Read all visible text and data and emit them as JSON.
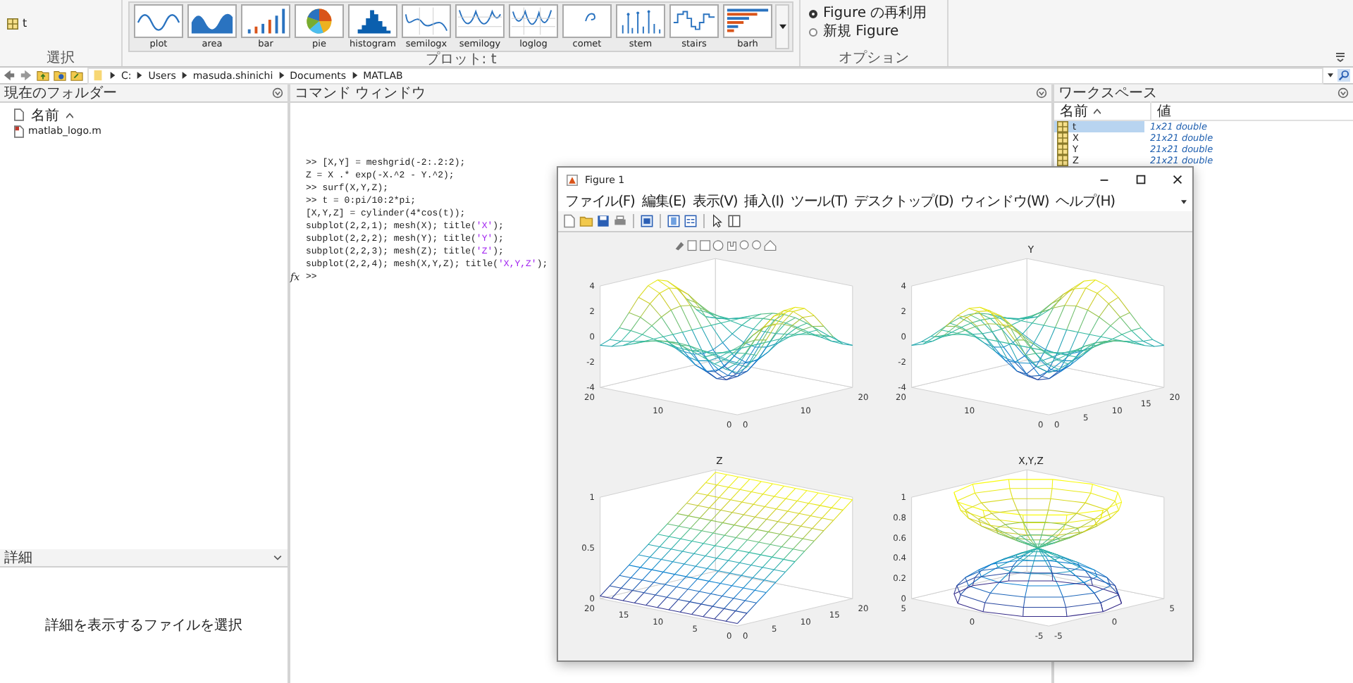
{
  "ribbon": {
    "variable": {
      "name": "t"
    },
    "select_label": "選択",
    "gallery": [
      {
        "label": "plot"
      },
      {
        "label": "area"
      },
      {
        "label": "bar"
      },
      {
        "label": "pie"
      },
      {
        "label": "histogram"
      },
      {
        "label": "semilogx"
      },
      {
        "label": "semilogy"
      },
      {
        "label": "loglog"
      },
      {
        "label": "comet"
      },
      {
        "label": "stem"
      },
      {
        "label": "stairs"
      },
      {
        "label": "barh"
      }
    ],
    "gallery_label": "プロット: t",
    "options": [
      {
        "label": "Figure の再利用",
        "selected": true
      },
      {
        "label": "新規 Figure",
        "selected": false
      }
    ],
    "options_label": "オプション"
  },
  "address_bar": {
    "path": [
      "C:",
      "Users",
      "masuda.shinichi",
      "Documents",
      "MATLAB"
    ]
  },
  "current_folder": {
    "title": "現在のフォルダー",
    "column": "名前",
    "files": [
      {
        "name": "matlab_logo.m"
      }
    ]
  },
  "details": {
    "title": "詳細",
    "message": "詳細を表示するファイルを選択"
  },
  "command_window": {
    "title": "コマンド ウィンドウ",
    "prompt_icon": "fx",
    "prompt": ">>",
    "lines": [
      {
        "segments": [
          {
            "kind": "code",
            "text": ">> [X,Y] = meshgrid(-2:.2:2);"
          }
        ]
      },
      {
        "segments": [
          {
            "kind": "code",
            "text": "Z = X .* exp(-X.^2 - Y.^2);"
          }
        ]
      },
      {
        "segments": [
          {
            "kind": "code",
            "text": ">> surf(X,Y,Z);"
          }
        ]
      },
      {
        "segments": [
          {
            "kind": "code",
            "text": ">> t = 0:pi/10:2*pi;"
          }
        ]
      },
      {
        "segments": [
          {
            "kind": "code",
            "text": "[X,Y,Z] = cylinder(4*cos(t));"
          }
        ]
      },
      {
        "segments": [
          {
            "kind": "code",
            "text": "subplot(2,2,1); mesh(X); title("
          },
          {
            "kind": "string",
            "text": "'X'"
          },
          {
            "kind": "code",
            "text": ");"
          }
        ]
      },
      {
        "segments": [
          {
            "kind": "code",
            "text": "subplot(2,2,2); mesh(Y); title("
          },
          {
            "kind": "string",
            "text": "'Y'"
          },
          {
            "kind": "code",
            "text": ");"
          }
        ]
      },
      {
        "segments": [
          {
            "kind": "code",
            "text": "subplot(2,2,3); mesh(Z); title("
          },
          {
            "kind": "string",
            "text": "'Z'"
          },
          {
            "kind": "code",
            "text": ");"
          }
        ]
      },
      {
        "segments": [
          {
            "kind": "code",
            "text": "subplot(2,2,4); mesh(X,Y,Z); title("
          },
          {
            "kind": "string",
            "text": "'X,Y,Z'"
          },
          {
            "kind": "code",
            "text": ");"
          }
        ]
      }
    ]
  },
  "workspace": {
    "title": "ワークスペース",
    "columns": [
      "名前",
      "値"
    ],
    "variables": [
      {
        "name": "t",
        "value": "1x21 double",
        "selected": true
      },
      {
        "name": "X",
        "value": "21x21 double",
        "selected": false
      },
      {
        "name": "Y",
        "value": "21x21 double",
        "selected": false
      },
      {
        "name": "Z",
        "value": "21x21 double",
        "selected": false
      }
    ]
  },
  "figure": {
    "title": "Figure 1",
    "menu": [
      "ファイル(F)",
      "編集(E)",
      "表示(V)",
      "挿入(I)",
      "ツール(T)",
      "デスクトップ(D)",
      "ウィンドウ(W)",
      "ヘルプ(H)"
    ],
    "subplot_rows": [
      {
        "subplots": [
          {
            "kind": "wave_x",
            "axes_toolbar": true,
            "z_ticks": [
              "4",
              "2",
              "0",
              "-2",
              "-4"
            ],
            "left_ticks": [
              "20",
              "10",
              "0"
            ],
            "right_ticks": [
              "0",
              "10",
              "20"
            ]
          },
          {
            "kind": "wave_y",
            "axes_toolbar": false,
            "title": "Y",
            "z_ticks": [
              "4",
              "2",
              "0",
              "-2",
              "-4"
            ],
            "left_ticks": [
              "20",
              "10",
              "0"
            ],
            "right_ticks": [
              "0",
              "5",
              "10",
              "15",
              "20"
            ]
          }
        ]
      },
      {
        "subplots": [
          {
            "kind": "plane",
            "axes_toolbar": false,
            "title": "Z",
            "z_ticks": [
              "1",
              "0.5",
              "0"
            ],
            "left_ticks": [
              "20",
              "15",
              "10",
              "5",
              "0"
            ],
            "right_ticks": [
              "0",
              "5",
              "10",
              "15",
              "20"
            ]
          },
          {
            "kind": "hourglass",
            "axes_toolbar": false,
            "title": "X,Y,Z",
            "z_ticks": [
              "1",
              "0.8",
              "0.6",
              "0.4",
              "0.2",
              "0"
            ],
            "left_ticks": [
              "5",
              "0",
              "-5"
            ],
            "right_ticks": [
              "-5",
              "0",
              "5"
            ]
          }
        ]
      }
    ]
  }
}
